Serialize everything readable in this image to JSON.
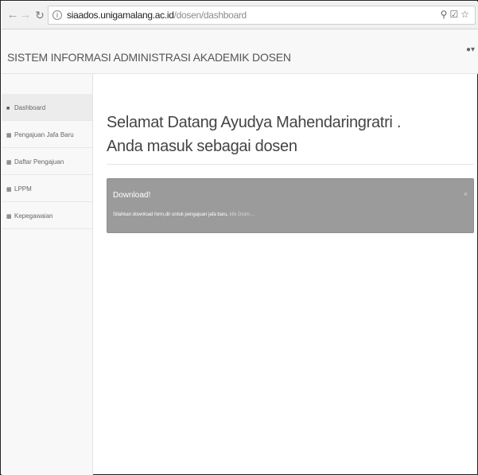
{
  "browser": {
    "url_host": "siaados.unigamalang.ac.id",
    "url_path": "/dosen/dashboard",
    "icons": [
      "zoom-icon",
      "extension-icon",
      "star-icon"
    ]
  },
  "header": {
    "title": "SISTEM INFORMASI ADMINISTRASI AKADEMIK DOSEN",
    "user_icon": "user-icon"
  },
  "sidebar": {
    "items": [
      {
        "label": "Dashboard",
        "icon": "dashboard-icon",
        "active": true
      },
      {
        "label": "Pengajuan Jafa Baru",
        "icon": "table-icon"
      },
      {
        "label": "Daftar Pengajuan",
        "icon": "table-icon"
      },
      {
        "label": "LPPM",
        "icon": "table-icon"
      },
      {
        "label": "Kepegawaian",
        "icon": "table-icon"
      }
    ]
  },
  "main": {
    "welcome_line1": "Selamat Datang Ayudya Mahendaringratri .",
    "welcome_line2": "Anda masuk sebagai dosen"
  },
  "alert": {
    "title": "Download!",
    "text": "Silahkan download form,dir untuk pengajuan jafa baru,",
    "link": "klik Disini ...",
    "close": "×"
  },
  "colors": {
    "alert_bg": "#9b9b9b",
    "sidebar_bg": "#f8f8f8"
  }
}
